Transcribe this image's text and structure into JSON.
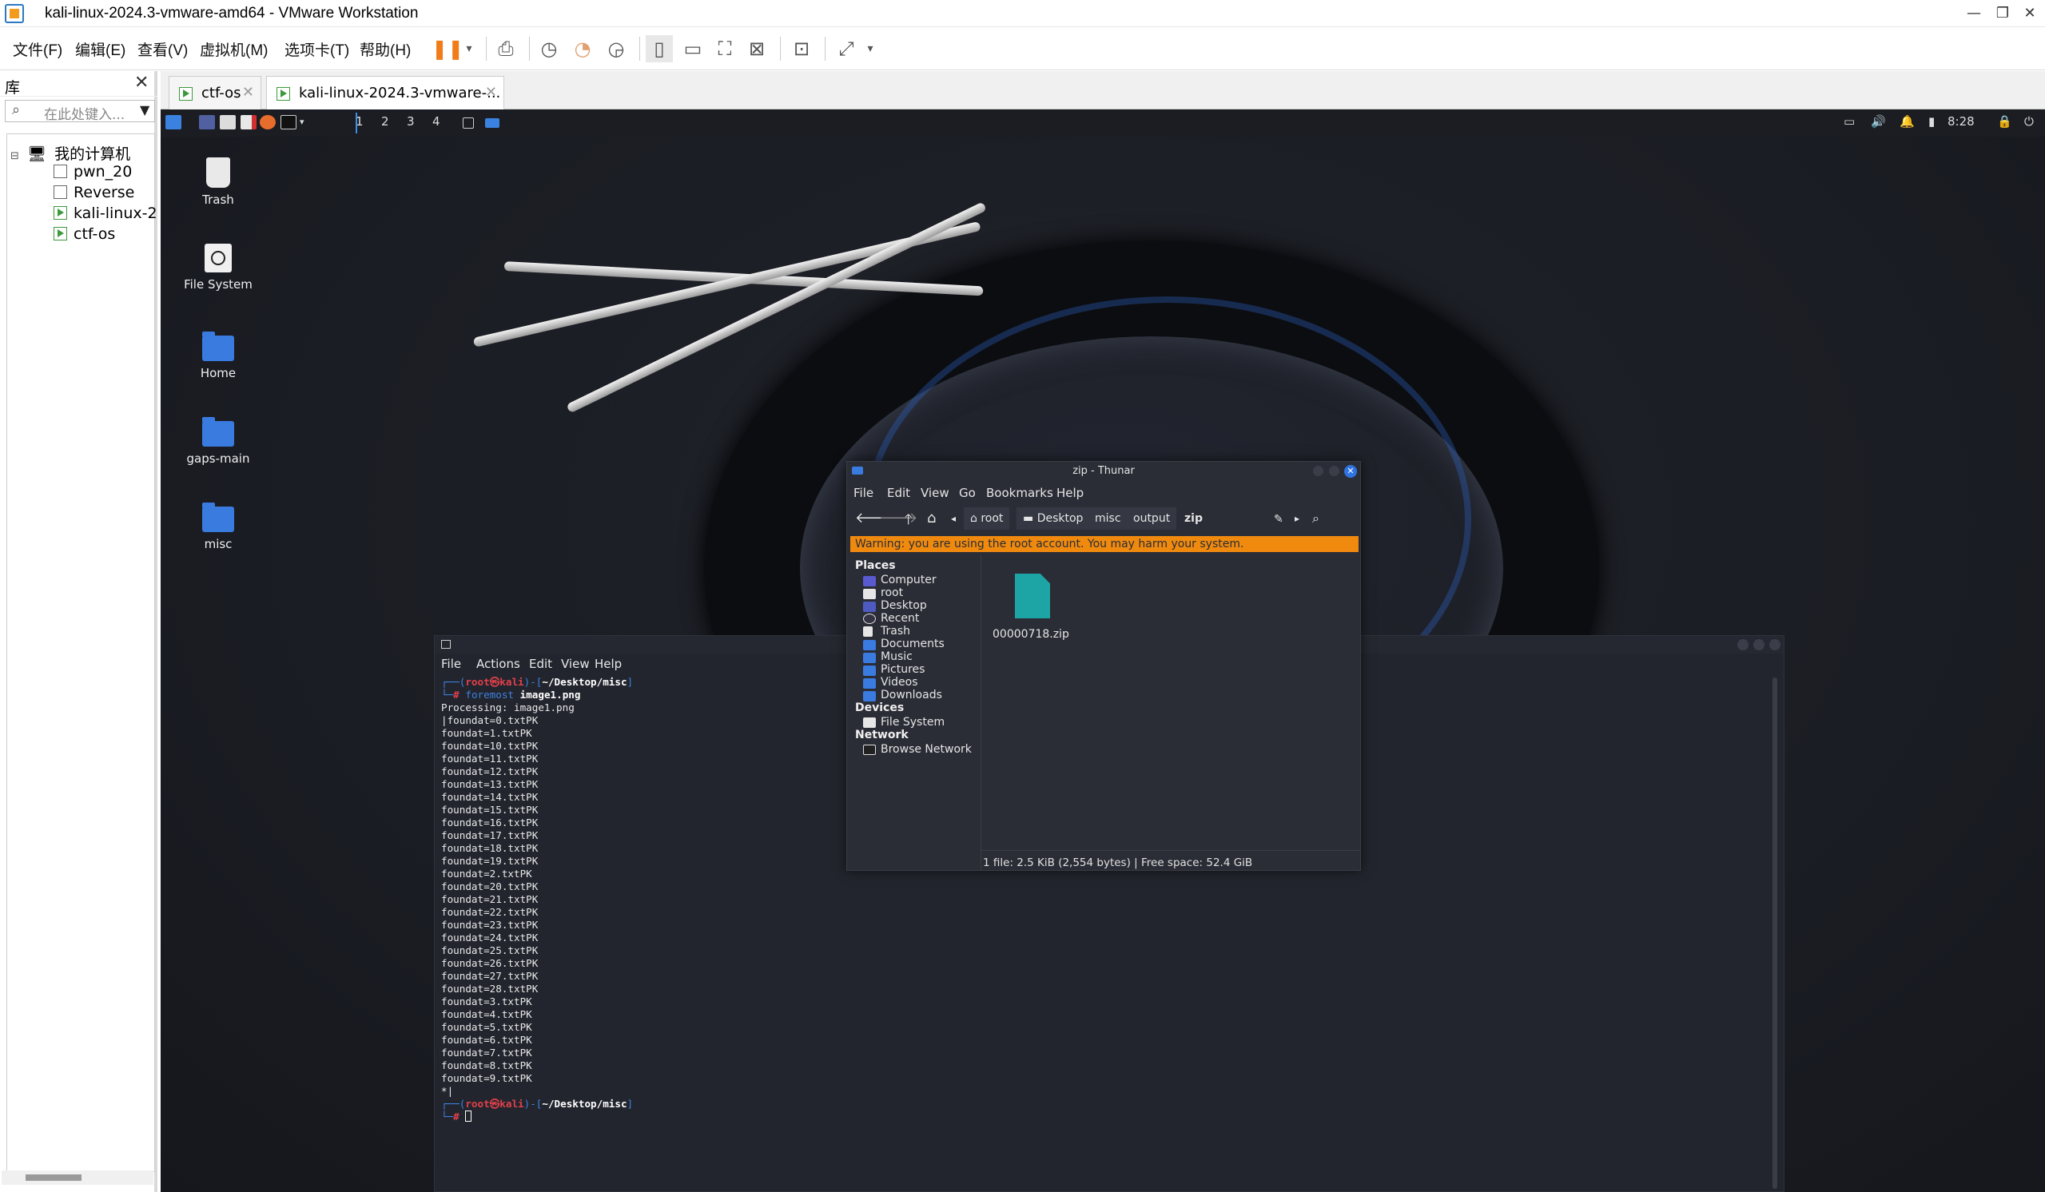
{
  "window": {
    "title": "kali-linux-2024.3-vmware-amd64 - VMware Workstation"
  },
  "menubar": {
    "items": [
      "文件(F)",
      "编辑(E)",
      "查看(V)",
      "虚拟机(M)",
      "选项卡(T)",
      "帮助(H)"
    ]
  },
  "library": {
    "title": "库",
    "search_placeholder": "在此处键入...",
    "root_label": "我的计算机",
    "vms": [
      "pwn_20",
      "Reverse",
      "kali-linux-2(",
      "ctf-os"
    ]
  },
  "tabs": [
    {
      "label": "ctf-os"
    },
    {
      "label": "kali-linux-2024.3-vmware-..."
    }
  ],
  "guest_panel": {
    "workspaces": [
      "1",
      "2",
      "3",
      "4"
    ],
    "clock": "8:28"
  },
  "desktop": {
    "icons": [
      {
        "label": "Trash",
        "icon": "trash-icon"
      },
      {
        "label": "File System",
        "icon": "drive-icon"
      },
      {
        "label": "Home",
        "icon": "home-folder-icon"
      },
      {
        "label": "gaps-main",
        "icon": "folder-icon"
      },
      {
        "label": "misc",
        "icon": "folder-icon"
      }
    ]
  },
  "terminal": {
    "menu": [
      "File",
      "Actions",
      "Edit",
      "View",
      "Help"
    ],
    "prompt_user": "root",
    "prompt_at": "㉿",
    "prompt_host": "kali",
    "prompt_path": "~/Desktop/misc",
    "command_name": "foremost",
    "command_arg": "image1.png",
    "output": [
      "Processing: image1.png",
      "|foundat=0.txtPK",
      "foundat=1.txtPK",
      "foundat=10.txtPK",
      "foundat=11.txtPK",
      "foundat=12.txtPK",
      "foundat=13.txtPK",
      "foundat=14.txtPK",
      "foundat=15.txtPK",
      "foundat=16.txtPK",
      "foundat=17.txtPK",
      "foundat=18.txtPK",
      "foundat=19.txtPK",
      "foundat=2.txtPK",
      "foundat=20.txtPK",
      "foundat=21.txtPK",
      "foundat=22.txtPK",
      "foundat=23.txtPK",
      "foundat=24.txtPK",
      "foundat=25.txtPK",
      "foundat=26.txtPK",
      "foundat=27.txtPK",
      "foundat=28.txtPK",
      "foundat=3.txtPK",
      "foundat=4.txtPK",
      "foundat=5.txtPK",
      "foundat=6.txtPK",
      "foundat=7.txtPK",
      "foundat=8.txtPK",
      "foundat=9.txtPK",
      "*|"
    ]
  },
  "thunar": {
    "title": "zip - Thunar",
    "menu": [
      "File",
      "Edit",
      "View",
      "Go",
      "Bookmarks",
      "Help"
    ],
    "breadcrumbs": [
      "root",
      "Desktop",
      "misc",
      "output",
      "zip"
    ],
    "warning": "Warning: you are using the root account. You may harm your system.",
    "places_header": "Places",
    "places": [
      "Computer",
      "root",
      "Desktop",
      "Recent",
      "Trash",
      "Documents",
      "Music",
      "Pictures",
      "Videos",
      "Downloads"
    ],
    "devices_header": "Devices",
    "devices": [
      "File System"
    ],
    "network_header": "Network",
    "network": [
      "Browse Network"
    ],
    "file_name": "00000718.zip",
    "status": "1 file: 2.5 KiB (2,554 bytes)  |  Free space: 52.4 GiB"
  },
  "colors": {
    "accent": "#3a7be0",
    "warning": "#f08a0f",
    "prompt_red": "#e0404a"
  }
}
